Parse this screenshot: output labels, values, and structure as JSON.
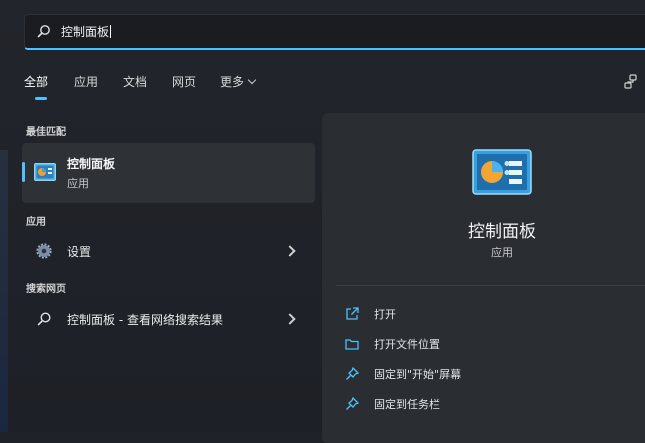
{
  "search": {
    "value": "控制面板"
  },
  "tabs": [
    {
      "label": "全部"
    },
    {
      "label": "应用"
    },
    {
      "label": "文档"
    },
    {
      "label": "网页"
    },
    {
      "label": "更多"
    }
  ],
  "best_match": {
    "header": "最佳匹配",
    "title": "控制面板",
    "subtitle": "应用",
    "icon": "control-panel-icon"
  },
  "apps": {
    "header": "应用",
    "items": [
      {
        "label": "设置",
        "icon": "settings-gear-icon"
      }
    ]
  },
  "web": {
    "header": "搜索网页",
    "items": [
      {
        "label": "控制面板 - 查看网络搜索结果",
        "icon": "search-icon"
      }
    ]
  },
  "detail": {
    "title": "控制面板",
    "subtitle": "应用",
    "actions": [
      {
        "label": "打开",
        "icon": "open-external-icon"
      },
      {
        "label": "打开文件位置",
        "icon": "folder-icon"
      },
      {
        "label": "固定到\"开始\"屏幕",
        "icon": "pin-icon"
      },
      {
        "label": "固定到任务栏",
        "icon": "pin-icon"
      }
    ]
  },
  "colors": {
    "accent": "#4cc2ff",
    "background": "#1f2228",
    "panel": "#2a2d32",
    "selected": "#2e3136"
  }
}
